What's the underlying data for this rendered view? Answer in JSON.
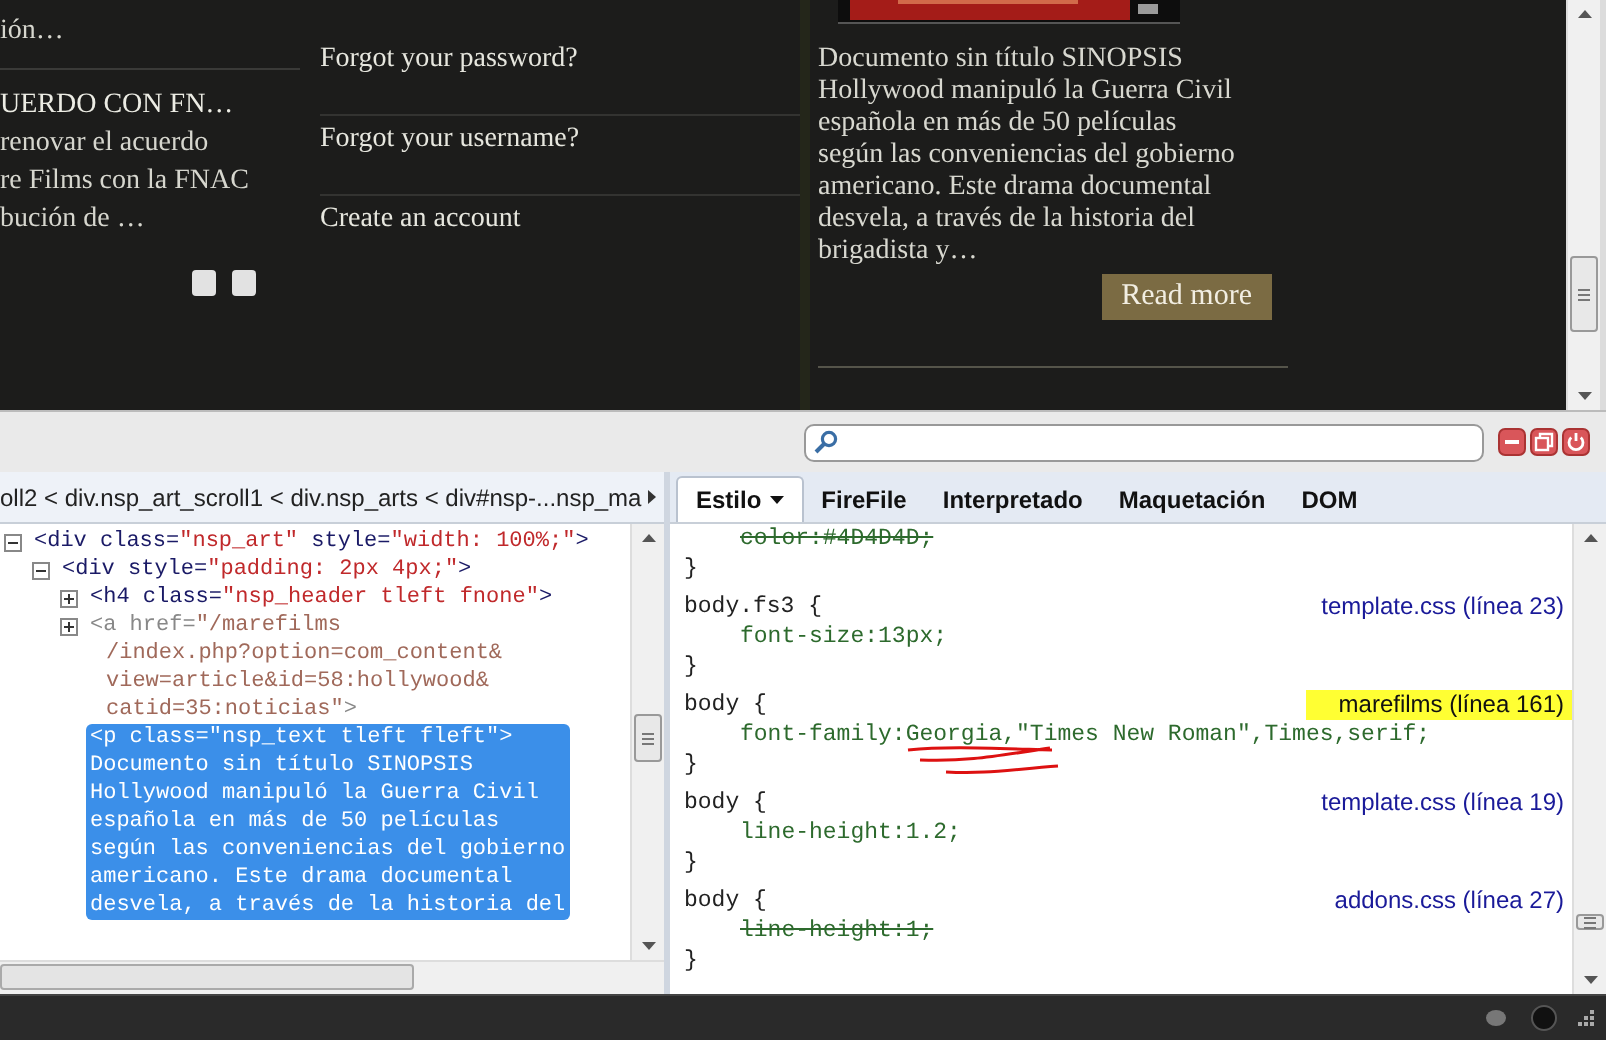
{
  "website": {
    "left_column": [
      {
        "text": "ión…",
        "kind": "body"
      },
      {
        "text": "UERDO CON FN…",
        "kind": "heading"
      },
      {
        "text": "renovar el acuerdo",
        "kind": "body"
      },
      {
        "text": "re Films con la FNAC",
        "kind": "body"
      },
      {
        "text": "bución de …",
        "kind": "body"
      }
    ],
    "slider_dots": [
      {
        "selected": false
      },
      {
        "selected": false
      }
    ],
    "links": [
      "Forgot your password?",
      "Forgot your username?",
      "Create an account"
    ],
    "article": {
      "text": "Documento sin título SINOPSIS Hollywood manipuló la Guerra Civil española en más de 50 películas según las conveniencias del gobierno americano. Este drama documental desvela, a través de la historia del brigadista y…",
      "button": "Read more"
    }
  },
  "firebug": {
    "breadcrumb": "oll2 < div.nsp_art_scroll1 < div.nsp_arts < div#nsp-...nsp_ma",
    "html_tree": [
      {
        "expanded": true,
        "kind": "element",
        "selected": false,
        "lines": [
          [
            {
              "text": "<div class=",
              "kind": "tag"
            },
            {
              "text": "\"nsp_art\"",
              "kind": "value"
            },
            {
              "text": " style=",
              "kind": "tag"
            },
            {
              "text": "\"width: 100%;\"",
              "kind": "value"
            },
            {
              "text": ">",
              "kind": "tag"
            }
          ]
        ],
        "children": [
          {
            "expanded": true,
            "kind": "element",
            "selected": false,
            "lines": [
              [
                {
                  "text": "<div style=",
                  "kind": "tag"
                },
                {
                  "text": "\"padding: 2px 4px;\"",
                  "kind": "value"
                },
                {
                  "text": ">",
                  "kind": "tag"
                }
              ]
            ],
            "children": [
              {
                "expanded": false,
                "kind": "element",
                "selected": false,
                "lines": [
                  [
                    {
                      "text": "<h4 class=",
                      "kind": "tag"
                    },
                    {
                      "text": "\"nsp_header tleft fnone\"",
                      "kind": "value"
                    },
                    {
                      "text": ">",
                      "kind": "tag"
                    }
                  ]
                ]
              },
              {
                "expanded": false,
                "kind": "dim",
                "selected": false,
                "lines": [
                  [
                    {
                      "text": "<a href=",
                      "kind": "tag"
                    },
                    {
                      "text": "\"/marefilms",
                      "kind": "value"
                    }
                  ],
                  [
                    {
                      "text": "/index.php?option=com_content&",
                      "kind": "value"
                    }
                  ],
                  [
                    {
                      "text": "view=article&id=58:hollywood&",
                      "kind": "value"
                    }
                  ],
                  [
                    {
                      "text": "catid=35:noticias\"",
                      "kind": "value"
                    },
                    {
                      "text": ">",
                      "kind": "tag"
                    }
                  ]
                ]
              },
              {
                "kind": "text",
                "selected": true,
                "lines": [
                  [
                    {
                      "text": "<p class=\"nsp_text tleft fleft\">",
                      "kind": "tag"
                    }
                  ],
                  [
                    {
                      "text": "Documento sin título SINOPSIS",
                      "kind": "tag"
                    }
                  ],
                  [
                    {
                      "text": "Hollywood manipuló la Guerra Civil",
                      "kind": "tag"
                    }
                  ],
                  [
                    {
                      "text": "española en más de 50 películas",
                      "kind": "tag"
                    }
                  ],
                  [
                    {
                      "text": "según las conveniencias del gobierno",
                      "kind": "tag"
                    }
                  ],
                  [
                    {
                      "text": "americano. Este drama documental",
                      "kind": "tag"
                    }
                  ],
                  [
                    {
                      "text": "desvela, a través de la historia del",
                      "kind": "tag"
                    }
                  ]
                ]
              }
            ]
          }
        ]
      }
    ],
    "tabs": [
      {
        "label": "Estilo",
        "selected": true,
        "menu": true
      },
      {
        "label": "FireFile",
        "selected": false,
        "menu": false
      },
      {
        "label": "Interpretado",
        "selected": false,
        "menu": false
      },
      {
        "label": "Maquetación",
        "selected": false,
        "menu": false
      },
      {
        "label": "DOM",
        "selected": false,
        "menu": false
      }
    ],
    "css_rules": [
      {
        "declarations": [
          {
            "text": "color:#4D4D4D;",
            "overridden": true
          }
        ],
        "close": "}"
      },
      {
        "selector": "body.fs3 {",
        "source": "template.css (línea 23)",
        "highlighted": false,
        "declarations": [
          {
            "text": "font-size:13px;",
            "overridden": false
          }
        ],
        "close": "}"
      },
      {
        "selector": "body {",
        "source": "marefilms (línea 161)",
        "highlighted": true,
        "declarations": [
          {
            "text": "font-family:Georgia,\"Times New Roman\",Times,serif;",
            "overridden": false,
            "scribble": true
          }
        ],
        "close": "}"
      },
      {
        "selector": "body {",
        "source": "template.css (línea 19)",
        "highlighted": false,
        "declarations": [
          {
            "text": "line-height:1.2;",
            "overridden": false
          }
        ],
        "close": "}"
      },
      {
        "selector": "body {",
        "source": "addons.css (línea 27)",
        "highlighted": false,
        "declarations": [
          {
            "text": "line-height:1;",
            "overridden": true
          }
        ],
        "close": "}"
      }
    ]
  }
}
